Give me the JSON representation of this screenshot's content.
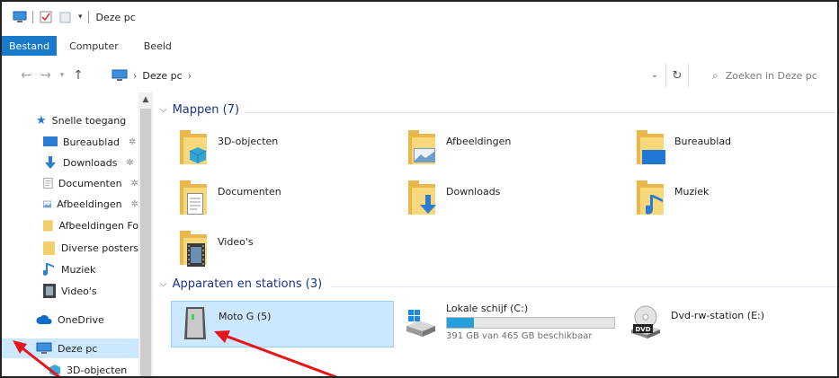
{
  "window": {
    "title": "Deze pc"
  },
  "ribbon": {
    "tabs": [
      "Bestand",
      "Computer",
      "Beeld"
    ]
  },
  "address": {
    "crumbs": [
      "Deze pc"
    ],
    "search_placeholder": "Zoeken in Deze pc"
  },
  "sidebar": {
    "quick_access": "Snelle toegang",
    "items": [
      {
        "label": "Bureaublad",
        "pinned": true,
        "icon": "desktop-icon"
      },
      {
        "label": "Downloads",
        "pinned": true,
        "icon": "download-arrow-icon"
      },
      {
        "label": "Documenten",
        "pinned": true,
        "icon": "document-icon"
      },
      {
        "label": "Afbeeldingen",
        "pinned": true,
        "icon": "picture-icon"
      },
      {
        "label": "Afbeeldingen Fo",
        "pinned": false,
        "icon": "folder-icon"
      },
      {
        "label": "Diverse posters",
        "pinned": false,
        "icon": "folder-icon"
      },
      {
        "label": "Muziek",
        "pinned": false,
        "icon": "music-note-icon"
      },
      {
        "label": "Video's",
        "pinned": false,
        "icon": "film-icon"
      }
    ],
    "onedrive": "OneDrive",
    "this_pc": "Deze pc",
    "sub_item": "3D-objecten"
  },
  "folders_group": {
    "header": "Mappen (7)",
    "items": [
      {
        "label": "3D-objecten",
        "overlay": "cube-icon"
      },
      {
        "label": "Afbeeldingen",
        "overlay": "picture-icon"
      },
      {
        "label": "Bureaublad",
        "overlay": "desktop-icon"
      },
      {
        "label": "Documenten",
        "overlay": "document-icon"
      },
      {
        "label": "Downloads",
        "overlay": "download-arrow-icon"
      },
      {
        "label": "Muziek",
        "overlay": "music-note-icon"
      },
      {
        "label": "Video's",
        "overlay": "film-icon"
      }
    ]
  },
  "devices_group": {
    "header": "Apparaten en stations (3)",
    "items": [
      {
        "label": "Moto G (5)",
        "icon": "phone-device-icon"
      },
      {
        "label": "Lokale schijf (C:)",
        "icon": "hard-drive-icon",
        "usage_text": "391 GB van 465 GB beschikbaar",
        "used_fraction": 0.159
      },
      {
        "label": "Dvd-rw-station (E:)",
        "icon": "dvd-drive-icon",
        "disc_label": "DVD"
      }
    ]
  },
  "colors": {
    "accent": "#1979ca",
    "selection": "#cce8ff",
    "folder": "#e8b84a",
    "annotation": "#e8141c"
  }
}
